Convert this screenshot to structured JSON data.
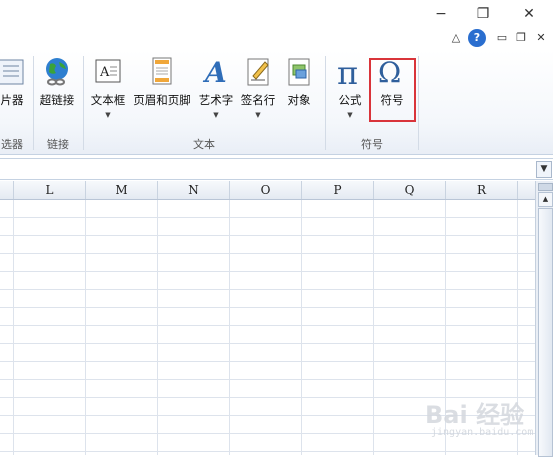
{
  "window": {
    "minimize": "−",
    "restore": "❐",
    "close": "✕"
  },
  "help_row": {
    "caret": "△",
    "help": "?",
    "min": "▭",
    "restore": "❐",
    "close": "✕"
  },
  "ribbon": {
    "buttons": {
      "picture_filter": "片器",
      "hyperlink": "超链接",
      "textbox": "文本框",
      "header_footer": "页眉和页脚",
      "wordart": "艺术字",
      "signature": "签名行",
      "object": "对象",
      "equation": "公式",
      "symbol": "符号"
    },
    "groups": {
      "filter": "选器",
      "links": "链接",
      "text": "文本",
      "symbols": "符号"
    }
  },
  "columns": [
    "L",
    "M",
    "N",
    "O",
    "P",
    "Q",
    "R"
  ],
  "watermark": {
    "logo": "Bai 经验",
    "url": "jingyan.baidu.com"
  }
}
